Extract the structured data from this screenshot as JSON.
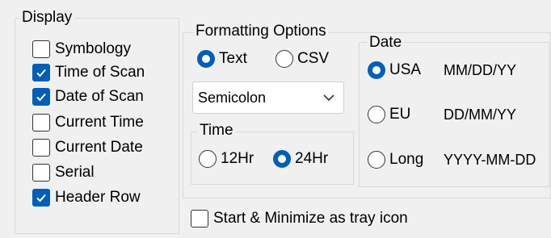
{
  "display": {
    "legend": "Display",
    "items": [
      {
        "label": "Symbology",
        "checked": false
      },
      {
        "label": "Time of Scan",
        "checked": true
      },
      {
        "label": "Date of Scan",
        "checked": true
      },
      {
        "label": "Current Time",
        "checked": false
      },
      {
        "label": "Current Date",
        "checked": false
      },
      {
        "label": "Serial",
        "checked": false
      },
      {
        "label": "Header Row",
        "checked": true
      }
    ]
  },
  "formatting": {
    "legend": "Formatting Options",
    "text_label": "Text",
    "csv_label": "CSV",
    "selected_format": "Text",
    "delimiter": "Semicolon"
  },
  "time": {
    "legend": "Time",
    "h12_label": "12Hr",
    "h24_label": "24Hr",
    "selected": "24Hr"
  },
  "date": {
    "legend": "Date",
    "options": [
      {
        "label": "USA",
        "format": "MM/DD/YY",
        "checked": true
      },
      {
        "label": "EU",
        "format": "DD/MM/YY",
        "checked": false
      },
      {
        "label": "Long",
        "format": "YYYY-MM-DD",
        "checked": false
      }
    ]
  },
  "tray": {
    "label": "Start & Minimize as tray icon",
    "checked": false
  },
  "colors": {
    "accent": "#005fb8",
    "background": "#f0f0f0",
    "group_border": "#d9d9d9"
  }
}
